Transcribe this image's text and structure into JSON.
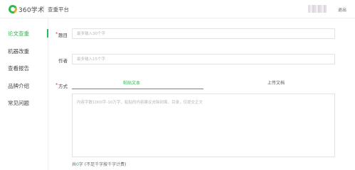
{
  "header": {
    "logo_text": "360学术",
    "platform": "查重平台",
    "logout": "退出"
  },
  "sidebar": {
    "items": [
      {
        "label": "论文查重",
        "active": true
      },
      {
        "label": "机器改重",
        "active": false
      },
      {
        "label": "查看报告",
        "active": false
      },
      {
        "label": "品牌介绍",
        "active": false
      },
      {
        "label": "常见问题",
        "active": false
      }
    ]
  },
  "form": {
    "required_mark": "*",
    "title": {
      "label": "题目",
      "placeholder": "最多输入30个字",
      "value": ""
    },
    "author": {
      "label": "作者",
      "placeholder": "最多输入15个字",
      "value": ""
    },
    "method": {
      "label": "方式",
      "tabs": [
        {
          "label": "粘贴文本",
          "active": true
        },
        {
          "label": "上传文档",
          "active": false
        }
      ]
    },
    "content": {
      "placeholder": "内容字数1000字-10万字，粘贴的内容建议去除封面、目录，仅提交正文",
      "value": ""
    },
    "count": {
      "prefix": "共",
      "value": "0",
      "unit": "字",
      "note": " (不足千字按千字计费)"
    }
  },
  "colors": {
    "accent": "#2db84d",
    "required": "#e34545"
  }
}
